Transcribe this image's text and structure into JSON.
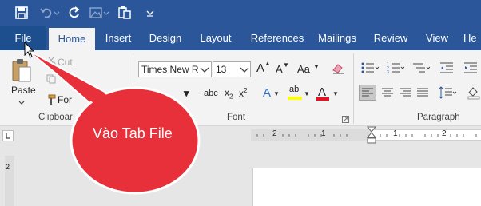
{
  "quick_access": {
    "save_icon": "save-icon",
    "undo_icon": "undo-icon",
    "redo_icon": "redo-icon",
    "picture_icon": "picture-icon",
    "paste_special_icon": "paste-special-icon",
    "customize_icon": "chevron-down-icon"
  },
  "tabs": [
    "File",
    "Home",
    "Insert",
    "Design",
    "Layout",
    "References",
    "Mailings",
    "Review",
    "View",
    "He"
  ],
  "ribbon": {
    "clipboard": {
      "paste_label": "Paste",
      "cut_label": "Cut",
      "format_painter_label": "For",
      "group_label": "Clipboar"
    },
    "font": {
      "font_name": "Times New R",
      "font_size": "13",
      "grow_label": "A",
      "shrink_label": "A",
      "case_label": "Aa",
      "strike_label": "abc",
      "subscript_label": "x",
      "subscript_sub": "2",
      "superscript_label": "x",
      "superscript_sup": "2",
      "effects_label": "A",
      "highlight_label": "ab",
      "color_label": "A",
      "group_label": "Font"
    },
    "paragraph": {
      "group_label": "Paragraph"
    }
  },
  "ruler": {
    "ticks": [
      "2",
      "1",
      "1",
      "2",
      "3",
      "4",
      "5",
      "6",
      "7"
    ],
    "vertical_mark": "2"
  },
  "callout": {
    "text": "Vào Tab File"
  },
  "colors": {
    "title_bar": "#2b579a",
    "ribbon_bg": "#f3f3f3",
    "callout_fill": "#e8303a",
    "highlight_yellow": "#ffff00",
    "font_color_red": "#e81123"
  }
}
